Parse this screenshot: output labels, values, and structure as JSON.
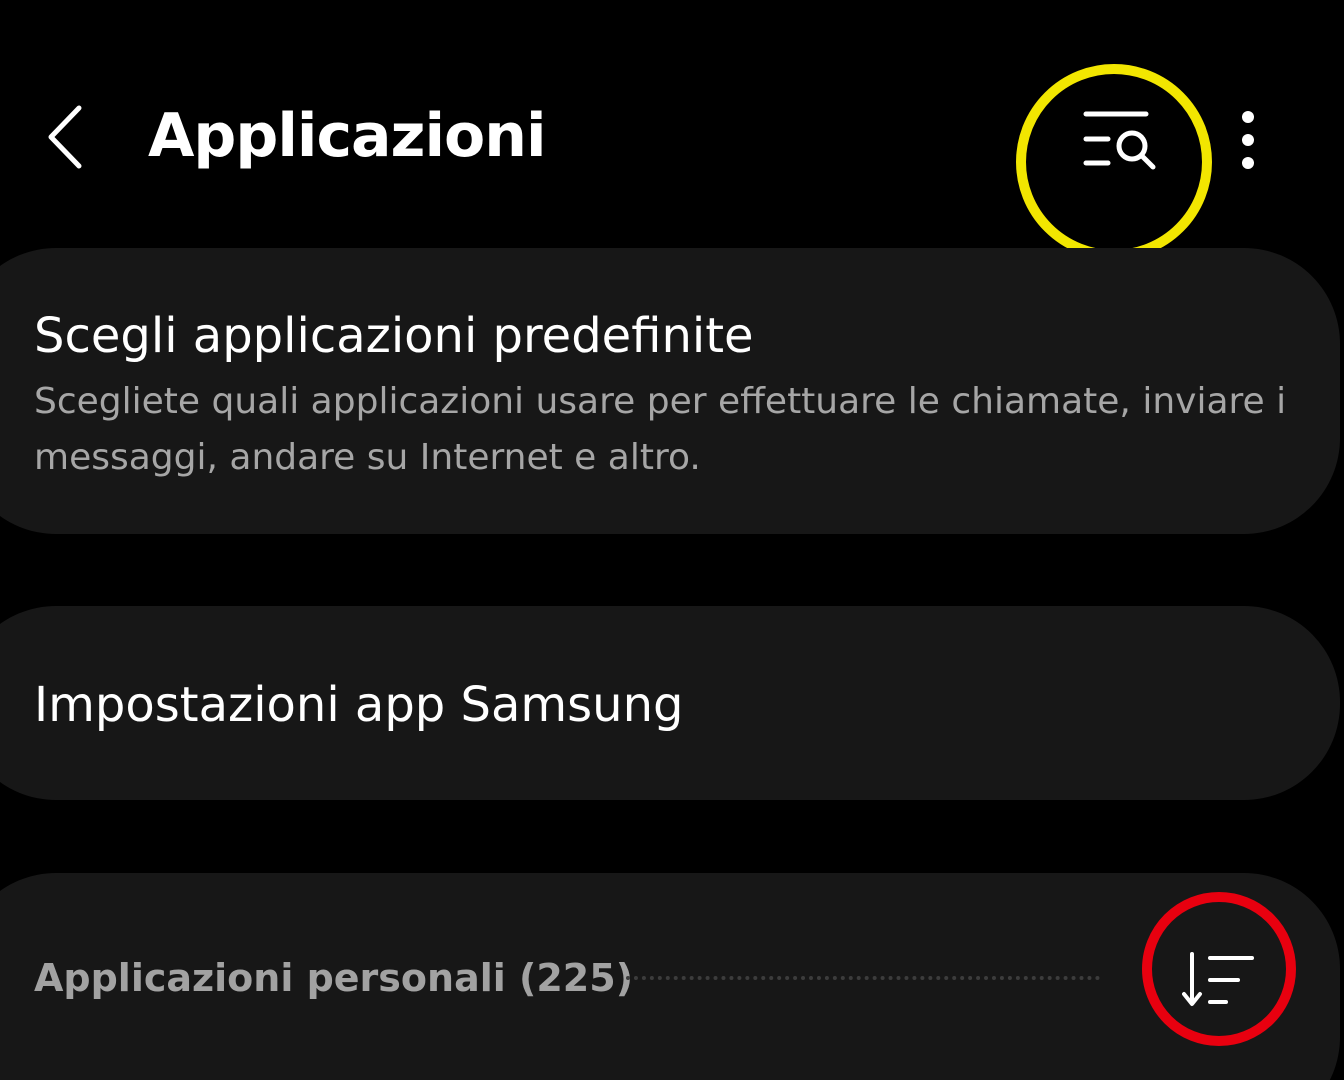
{
  "header": {
    "back_icon": "chevron-left-icon",
    "title": "Applicazioni",
    "search_icon": "list-search-icon",
    "more_icon": "more-vertical-icon"
  },
  "cards": {
    "default_apps": {
      "title": "Scegli applicazioni predefinite",
      "subtitle": "Scegliete quali applicazioni usare per effettuare le chiamate, inviare i messaggi, andare su Internet e altro."
    },
    "samsung_settings": {
      "title": "Impostazioni app Samsung"
    },
    "personal_apps": {
      "label": "Applicazioni personali (225)",
      "sort_icon": "sort-icon"
    }
  },
  "annotations": {
    "yellow_circle_color": "#f2e600",
    "red_circle_color": "#e8000f"
  },
  "colors": {
    "background": "#000000",
    "card": "#171717",
    "title_text": "#ffffff",
    "secondary_text": "#a6a6a6"
  }
}
